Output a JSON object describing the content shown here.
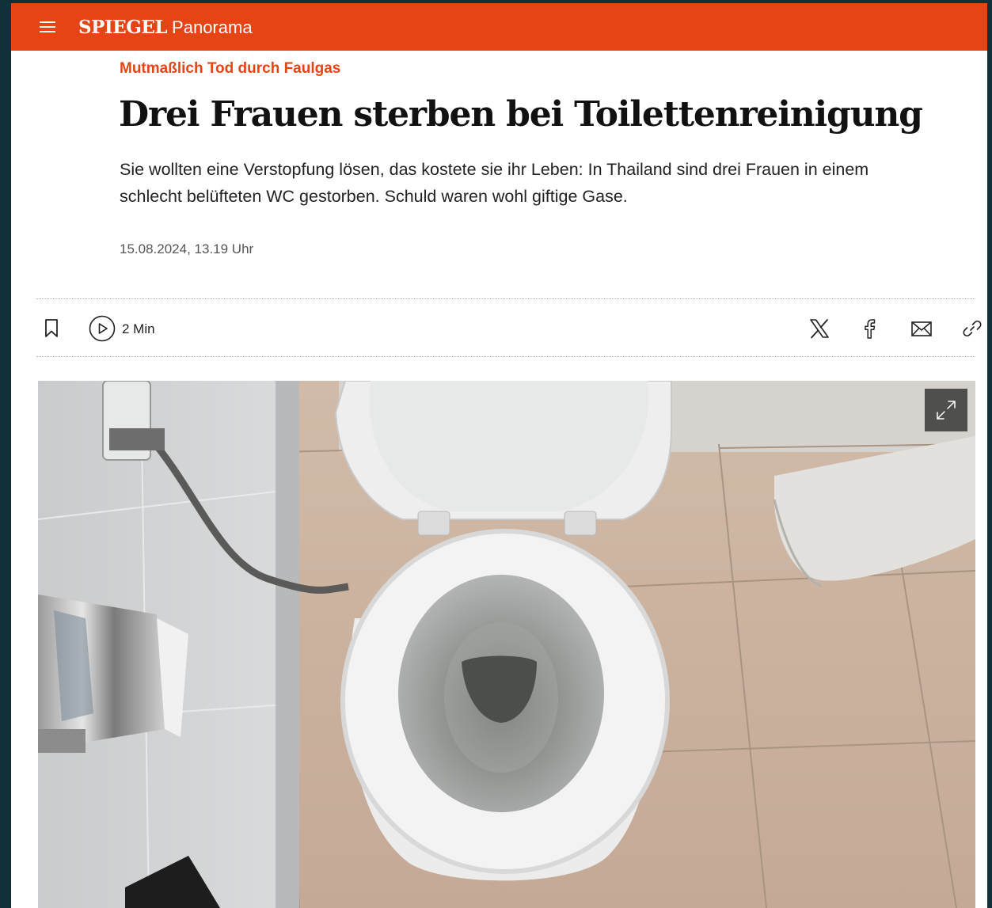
{
  "header": {
    "brand": "SPIEGEL",
    "section": "Panorama",
    "menu_icon": "hamburger-menu-icon",
    "color": "#e64415"
  },
  "article": {
    "kicker": "Mutmaßlich Tod durch Faulgas",
    "headline": "Drei Frauen sterben bei Toilettenreinigung",
    "teaser": "Sie wollten eine Verstopfung lösen, das kostete sie ihr Leben: In Thailand sind drei Frauen in einem schlecht belüfteten WC gestorben. Schuld waren wohl giftige Gase.",
    "date": "15.08.2024, 13.19 Uhr"
  },
  "toolbar": {
    "bookmark_icon": "bookmark-icon",
    "listen_icon": "play-circle-icon",
    "listen_label": "2 Min",
    "share": [
      {
        "icon": "x-icon"
      },
      {
        "icon": "facebook-icon"
      },
      {
        "icon": "mail-icon"
      },
      {
        "icon": "link-icon"
      }
    ]
  },
  "image": {
    "expand_icon": "expand-icon"
  }
}
